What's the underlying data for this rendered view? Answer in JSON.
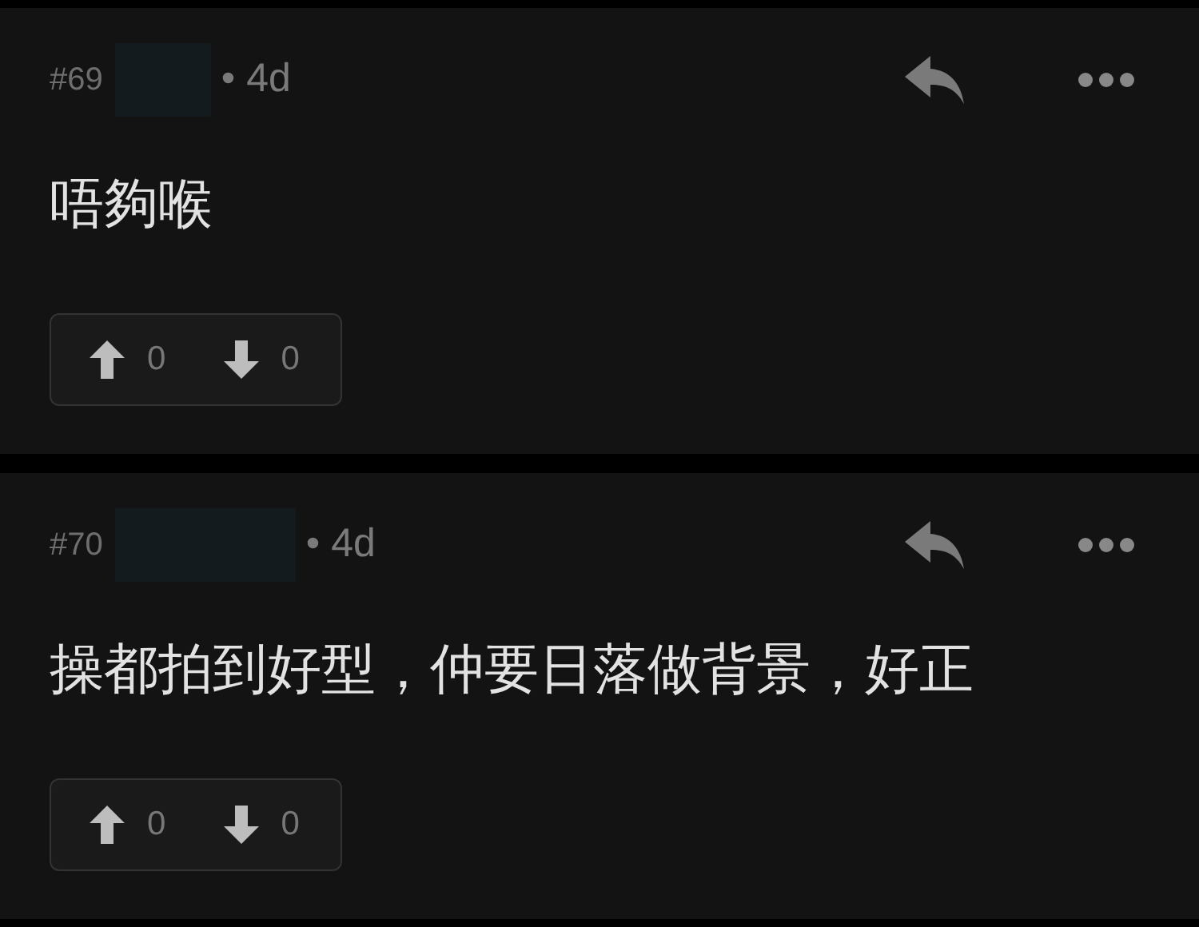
{
  "comments": [
    {
      "number": "#69",
      "author": {
        "kind": "redacted"
      },
      "age": "• 4d",
      "body": "唔夠喉",
      "upvotes": "0",
      "downvotes": "0"
    },
    {
      "number": "#70",
      "author": {
        "kind": "redacted"
      },
      "age": "• 4d",
      "body": "操都拍到好型，仲要日落做背景，好正",
      "upvotes": "0",
      "downvotes": "0"
    }
  ]
}
